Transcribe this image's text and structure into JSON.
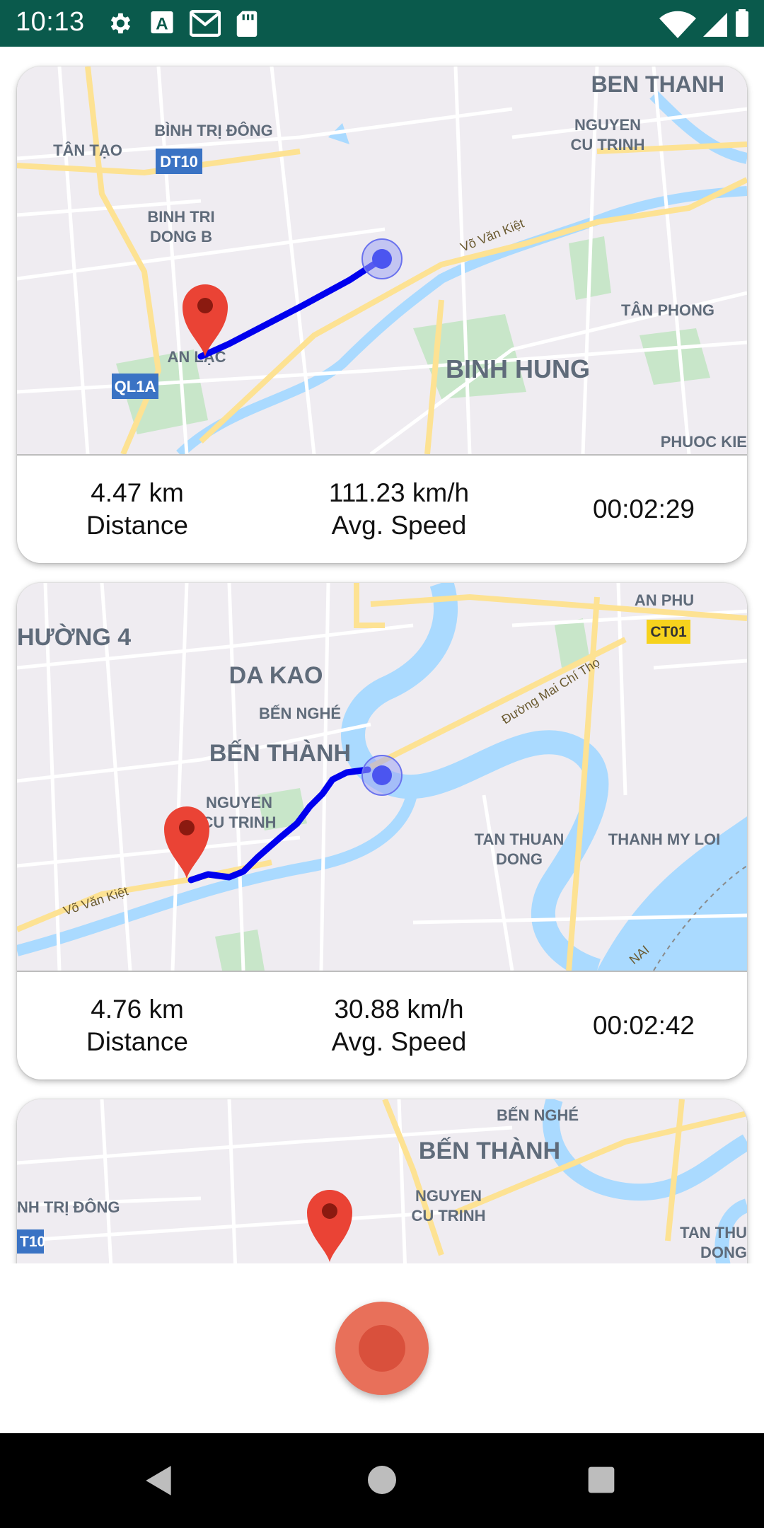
{
  "status_bar": {
    "time": "10:13",
    "icons_left": [
      "settings-icon",
      "a-badge-icon",
      "gmail-icon",
      "sd-card-icon"
    ],
    "icons_right": [
      "wifi-icon",
      "signal-icon",
      "battery-icon"
    ]
  },
  "trips": [
    {
      "distance": "4.47 km",
      "distance_label": "Distance",
      "speed": "111.23 km/h",
      "speed_label": "Avg. Speed",
      "duration": "00:02:29",
      "map_labels": {
        "l1": "BEN THANH",
        "l2": "NGUYEN",
        "l3": "CU TRINH",
        "l4": "BÌNH TRỊ ĐÔNG",
        "l5": "TÂN TẠO",
        "l6": "DT10",
        "l7": "BINH TRI",
        "l8": "DONG B",
        "l9": "Võ Văn Kiệt",
        "l10": "TÂN PHONG",
        "l11": "AN LẠC",
        "l12": "QL1A",
        "l13": "BINH HUNG",
        "l14": "PHUOC KIE"
      }
    },
    {
      "distance": "4.76 km",
      "distance_label": "Distance",
      "speed": "30.88 km/h",
      "speed_label": "Avg. Speed",
      "duration": "00:02:42",
      "map_labels": {
        "l1": "AN PHU",
        "l2": "CT01",
        "l3": "HƯỜNG 4",
        "l4": "DA KAO",
        "l5": "Đường Mai Chí Thọ",
        "l6": "BẾN NGHÉ",
        "l7": "BẾN THÀNH",
        "l8": "NGUYEN",
        "l9": "CU TRINH",
        "l10": "TAN THUAN",
        "l11": "DONG",
        "l12": "THANH MY LOI",
        "l13": "Võ Văn Kiệt",
        "l14": "NAI"
      }
    },
    {
      "map_labels": {
        "l1": "BẾN NGHÉ",
        "l2": "BẾN THÀNH",
        "l3": "NGUYEN",
        "l4": "CU TRINH",
        "l5": "NH TRỊ ĐÔNG",
        "l6": "T10",
        "l7": "TAN THU",
        "l8": "DONG"
      }
    }
  ],
  "colors": {
    "status_bar": "#0a5a4c",
    "route": "#0000ee",
    "pin": "#ea4335",
    "fab": "#e8705a",
    "fab_inner": "#d9503c",
    "map_bg": "#efecf1",
    "water": "#aadaff",
    "park": "#c8e6c9"
  },
  "fab": {
    "icon": "record-icon"
  },
  "nav_bar": {
    "icons": [
      "back-icon",
      "home-icon",
      "recents-icon"
    ]
  }
}
